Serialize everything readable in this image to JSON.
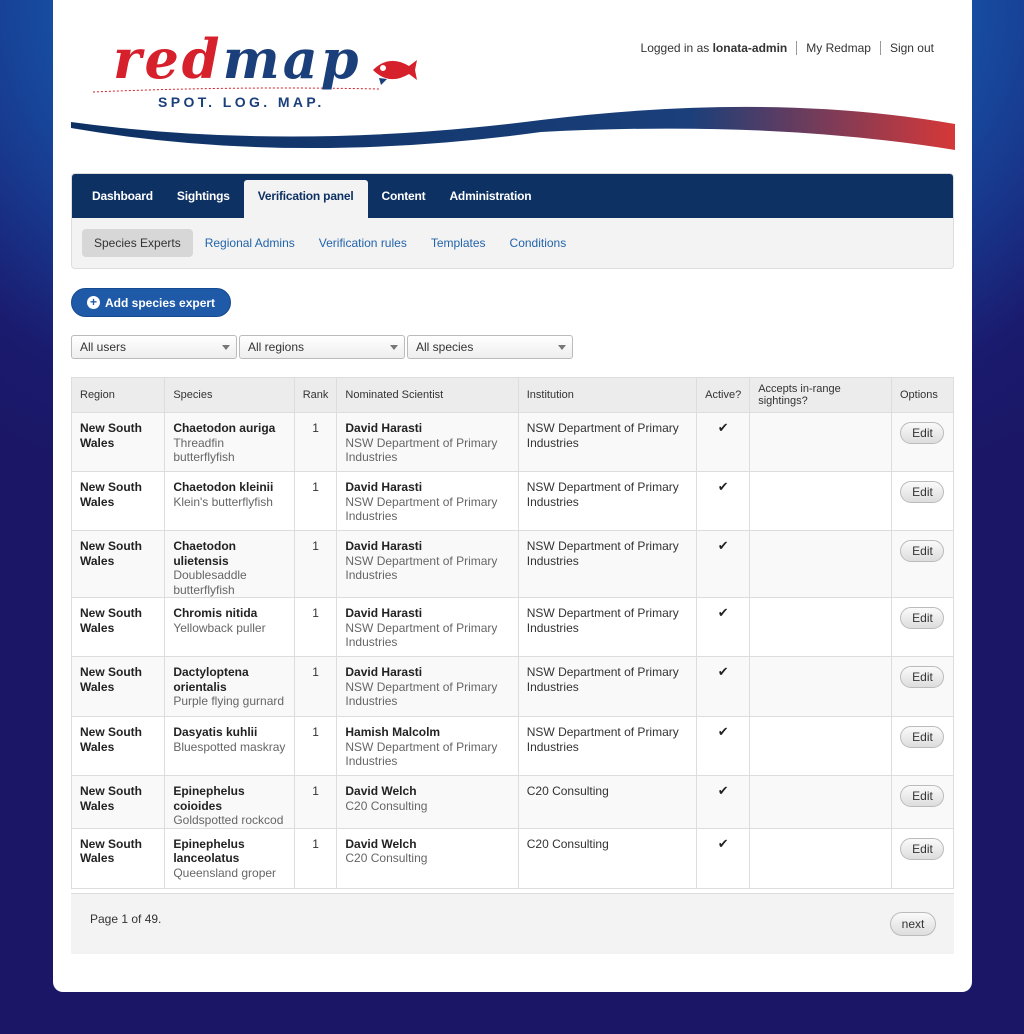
{
  "header": {
    "logo_text": "redmap",
    "logo_tagline": "SPOT. LOG. MAP.",
    "logged_in_prefix": "Logged in as",
    "username": "lonata-admin",
    "links": [
      "My Redmap",
      "Sign out"
    ]
  },
  "nav": {
    "tabs": [
      "Dashboard",
      "Sightings",
      "Verification panel",
      "Content",
      "Administration"
    ],
    "active_tab": "Verification panel",
    "subtabs": [
      "Species Experts",
      "Regional Admins",
      "Verification rules",
      "Templates",
      "Conditions"
    ],
    "active_subtab": "Species Experts"
  },
  "add_button": "Add species expert",
  "filters": [
    "All users",
    "All regions",
    "All species"
  ],
  "table": {
    "headers": [
      "Region",
      "Species",
      "Rank",
      "Nominated Scientist",
      "Institution",
      "Active?",
      "Accepts in-range sightings?",
      "Options"
    ],
    "rows": [
      {
        "region": "New South Wales",
        "species": "Chaetodon auriga",
        "common": "Threadfin butterflyfish",
        "rank": "1",
        "scientist": "David Harasti",
        "sci_inst": "NSW Department of Primary Industries",
        "institution": "NSW Department of Primary Industries",
        "active": "✔",
        "accepts": "",
        "option": "Edit"
      },
      {
        "region": "New South Wales",
        "species": "Chaetodon kleinii",
        "common": "Klein's butterflyfish",
        "rank": "1",
        "scientist": "David Harasti",
        "sci_inst": "NSW Department of Primary Industries",
        "institution": "NSW Department of Primary Industries",
        "active": "✔",
        "accepts": "",
        "option": "Edit"
      },
      {
        "region": "New South Wales",
        "species": "Chaetodon ulietensis",
        "common": "Doublesaddle butterflyfish",
        "rank": "1",
        "scientist": "David Harasti",
        "sci_inst": "NSW Department of Primary Industries",
        "institution": "NSW Department of Primary Industries",
        "active": "✔",
        "accepts": "",
        "option": "Edit"
      },
      {
        "region": "New South Wales",
        "species": "Chromis nitida",
        "common": "Yellowback puller",
        "rank": "1",
        "scientist": "David Harasti",
        "sci_inst": "NSW Department of Primary Industries",
        "institution": "NSW Department of Primary Industries",
        "active": "✔",
        "accepts": "",
        "option": "Edit"
      },
      {
        "region": "New South Wales",
        "species": "Dactyloptena orientalis",
        "common": "Purple flying gurnard",
        "rank": "1",
        "scientist": "David Harasti",
        "sci_inst": "NSW Department of Primary Industries",
        "institution": "NSW Department of Primary Industries",
        "active": "✔",
        "accepts": "",
        "option": "Edit"
      },
      {
        "region": "New South Wales",
        "species": "Dasyatis kuhlii",
        "common": "Bluespotted maskray",
        "rank": "1",
        "scientist": "Hamish Malcolm",
        "sci_inst": "NSW Department of Primary Industries",
        "institution": "NSW Department of Primary Industries",
        "active": "✔",
        "accepts": "",
        "option": "Edit"
      },
      {
        "region": "New South Wales",
        "species": "Epinephelus coioides",
        "common": "Goldspotted rockcod",
        "rank": "1",
        "scientist": "David Welch",
        "sci_inst": "C20 Consulting",
        "institution": "C20 Consulting",
        "active": "✔",
        "accepts": "",
        "option": "Edit"
      },
      {
        "region": "New South Wales",
        "species": "Epinephelus lanceolatus",
        "common": "Queensland groper",
        "rank": "1",
        "scientist": "David Welch",
        "sci_inst": "C20 Consulting",
        "institution": "C20 Consulting",
        "active": "✔",
        "accepts": "",
        "option": "Edit"
      }
    ]
  },
  "pager": {
    "info": "Page 1 of 49.",
    "next": "next"
  },
  "colors": {
    "nav_bg": "#0e3164",
    "link": "#2364aa",
    "logo_red": "#d6202b",
    "logo_blue": "#1a3f7a",
    "button_blue": "#1f5aa8"
  }
}
